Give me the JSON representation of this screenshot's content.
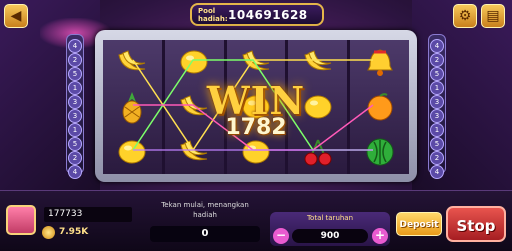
{
  "header": {
    "pool_label": "Pool hadiah:",
    "pool_value": "104691628"
  },
  "paylines": {
    "left": [
      "4",
      "2",
      "5",
      "1",
      "3",
      "3",
      "1",
      "5",
      "2",
      "4"
    ],
    "right": [
      "4",
      "2",
      "5",
      "1",
      "3",
      "3",
      "1",
      "5",
      "2",
      "4"
    ]
  },
  "reels": [
    [
      "banana",
      "pineapple",
      "lemon"
    ],
    [
      "lemon",
      "banana",
      "banana"
    ],
    [
      "banana",
      "lemon",
      "lemon"
    ],
    [
      "banana",
      "lemon",
      "cherries"
    ],
    [
      "bell",
      "orange",
      "watermelon"
    ]
  ],
  "win": {
    "title": "WIN",
    "amount": "1782"
  },
  "player": {
    "username": "177733",
    "balance": "7.95K"
  },
  "instruction": "Tekan mulai, menangkan hadiah",
  "current_win": "0",
  "bet": {
    "label": "Total taruhan",
    "value": "900",
    "minus": "−",
    "plus": "+"
  },
  "buttons": {
    "deposit": "Deposit",
    "stop": "Stop"
  },
  "colors": {
    "accent_gold": "#ffd040",
    "stop_red": "#d8383a",
    "bet_pink": "#e95bd0"
  }
}
